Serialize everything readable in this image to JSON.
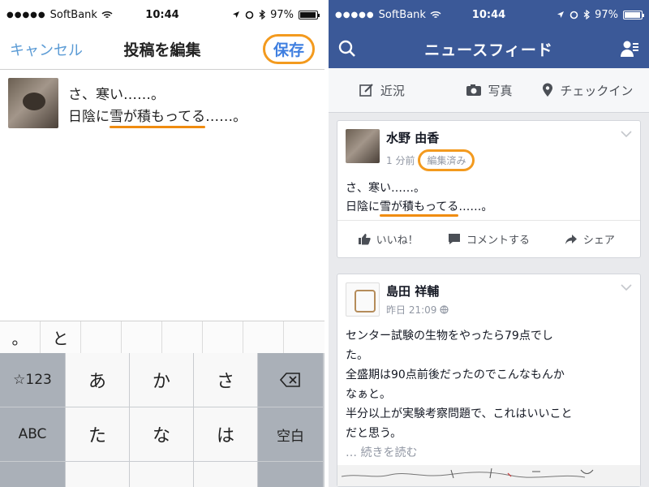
{
  "left": {
    "status": {
      "carrier": "SoftBank",
      "time": "10:44",
      "battery": "97%",
      "battery_level": 0.97
    },
    "nav": {
      "cancel": "キャンセル",
      "title": "投稿を編集",
      "save": "保存"
    },
    "compose": {
      "line1": "さ、寒い……。",
      "line2_a": "日陰に",
      "line2_u": "雪が積もってる",
      "line2_b": "……。"
    },
    "candidates": [
      "。",
      "と",
      "",
      "",
      "",
      "",
      "",
      ""
    ],
    "keyboard": {
      "num": "☆123",
      "a": "あ",
      "ka": "か",
      "sa": "さ",
      "abc": "ABC",
      "ta": "た",
      "na": "な",
      "ha": "は",
      "space": "空白"
    }
  },
  "right": {
    "status": {
      "carrier": "SoftBank",
      "time": "10:44",
      "battery": "97%",
      "battery_level": 0.97
    },
    "title": "ニュースフィード",
    "compose": {
      "status": "近況",
      "photo": "写真",
      "checkin": "チェックイン"
    },
    "post1": {
      "name": "水野 由香",
      "time": "1 分前",
      "edited": "編集済み",
      "line1": "さ、寒い……。",
      "line2_a": "日陰に",
      "line2_u": "雪が積もってる",
      "line2_b": "……。",
      "like": "いいね！",
      "comment": "コメントする",
      "share": "シェア"
    },
    "post2": {
      "name": "島田 祥輔",
      "time": "昨日 21:09",
      "lines": [
        "センター試験の生物をやったら79点でし",
        "た。",
        "全盛期は90点前後だったのでこんなもんか",
        "なぁと。",
        "半分以上が実験考察問題で、これはいいこと",
        "だと思う。"
      ],
      "more": "… 続きを読む"
    }
  },
  "colors": {
    "facebook_blue": "#3b5998",
    "ios_blue": "#3f7fe0",
    "highlight_orange": "#f39a1e"
  }
}
